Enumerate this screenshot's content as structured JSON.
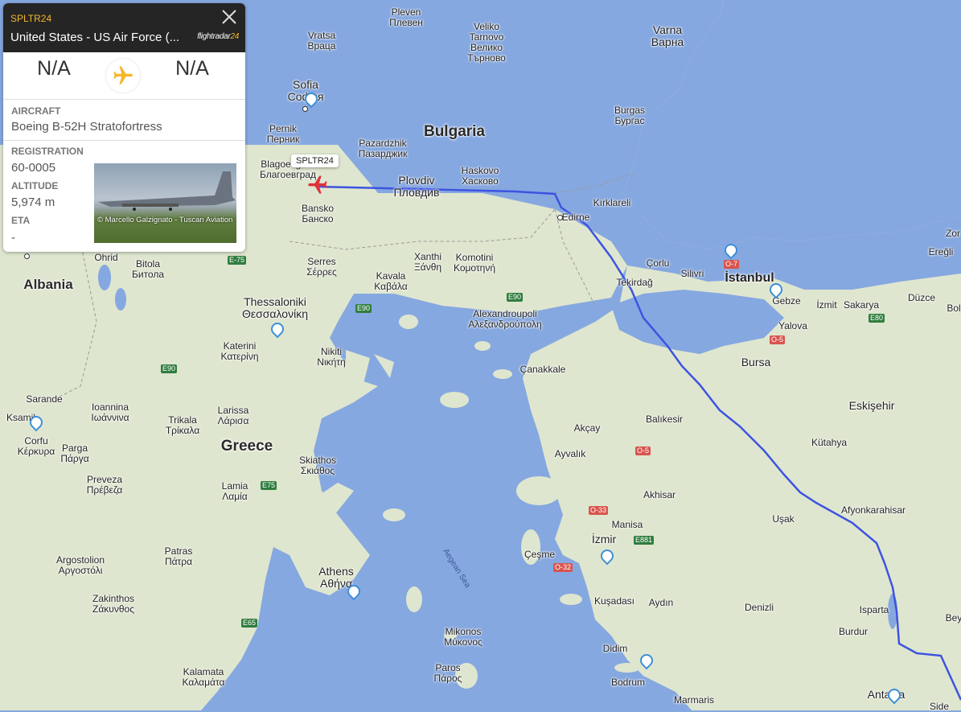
{
  "panel": {
    "callsign": "SPLTR24",
    "operator": "United States - US Air Force (...",
    "logo_main": "flightradar",
    "logo_num": "24",
    "origin": "N/A",
    "destination": "N/A",
    "aircraft_label": "AIRCRAFT",
    "aircraft_value": "Boeing B-52H Stratofortress",
    "registration_label": "REGISTRATION",
    "registration_value": "60-0005",
    "altitude_label": "ALTITUDE",
    "altitude_value": "5,974 m",
    "eta_label": "ETA",
    "eta_value": "-",
    "photo_credit": "© Marcello Galzignato - Tuscan Aviation",
    "close_icon": "close-icon",
    "plane_icon": "airplane-icon"
  },
  "flight_tag": "SPLTR24",
  "colors": {
    "sea": "#86a8e0",
    "land": "#dfe6cf",
    "track": "#3d54e0",
    "accent": "#f5b72a",
    "plane": "#e0303a"
  },
  "labels": {
    "pleven": "Pleven\nПлевен",
    "veliko": "Veliko\nTarnovo\nВелико\nТърново",
    "varna": "Varna\nВарна",
    "vratsa": "Vratsa\nВраца",
    "sofia": "Sofia\nСофия",
    "bulgaria": "Bulgaria",
    "burgas": "Burgas\nБургас",
    "pernik": "Pernik\nПерник",
    "pazardzhik": "Pazardzhik\nПазарджик",
    "blagoevgrad": "Blagoevgrad\nБлагоевград",
    "plovdiv": "Plovdiv\nПловдив",
    "haskovo": "Haskovo\nХасково",
    "kirklareli": "Kırklareli",
    "edirne": "Edirne",
    "bansko": "Bansko\nБанско",
    "ohrid": "Ohrid",
    "bitola": "Bitola\nБитола",
    "albania": "Albania",
    "serres": "Serres\nΣέρρες",
    "xanthi": "Xanthi\nΞάνθη",
    "komotini": "Komotini\nΚομοτηνή",
    "kavala": "Kavala\nΚαβάλα",
    "corlu": "Çorlu",
    "silivri": "Silivri",
    "istanbul": "İstanbul",
    "tekirdag": "Tekirdağ",
    "gebze": "Gebze",
    "izmit": "İzmit",
    "sakarya": "Sakarya",
    "duzce": "Düzce",
    "eregli": "Ereğli",
    "zor": "Zor",
    "bol": "Bol",
    "yalova": "Yalova",
    "thessaloniki": "Thessaloniki\nΘεσσαλονίκη",
    "alexandroupoli": "Alexandroupoli\nΑλεξανδρούπολη",
    "katerini": "Katerini\nΚατερίνη",
    "nikiti": "Nikiti\nΝικήτη",
    "canakkale": "Çanakkale",
    "bursa": "Bursa",
    "eskisehir": "Eskişehir",
    "sarande": "Sarande",
    "ksamil": "Ksamil",
    "ioannina": "Ioannina\nΙωάννινα",
    "trikala": "Trikala\nΤρίκαλα",
    "larissa": "Larissa\nΛάρισα",
    "corfu": "Corfu\nΚέρκυρα",
    "parga": "Parga\nΠάργα",
    "balikesir": "Balıkesir",
    "kutahya": "Kütahya",
    "akcay": "Akçay",
    "ayvalik": "Ayvalık",
    "greece": "Greece",
    "skiathos": "Skiathos\nΣκιάθος",
    "preveza": "Preveza\nΠρέβεζα",
    "lamia": "Lamia\nΛαμία",
    "akhisar": "Akhisar",
    "afyon": "Afyonkarahisar",
    "usak": "Uşak",
    "manisa": "Manisa",
    "izmir": "İzmir",
    "cesme": "Çeşme",
    "argostolion": "Argostolion\nΑργοστόλι",
    "patras": "Patras\nΠάτρα",
    "athens": "Athens\nΑθήνα",
    "aegean": "Aegean Sea",
    "kusadasi": "Kuşadası",
    "aydin": "Aydın",
    "denizli": "Denizli",
    "isparta": "Isparta",
    "burdur": "Burdur",
    "zakinthos": "Zakinthos\nΖάκυνθος",
    "mikonos": "Mikonos\nΜύκονος",
    "didim": "Didim",
    "paros": "Paros\nΠάρος",
    "bodrum": "Bodrum",
    "kalamata": "Kalamata\nΚαλαμάτα",
    "marmaris": "Marmaris",
    "antalya": "Antalya",
    "side": "Side",
    "bey": "Bey"
  },
  "roads": {
    "e75a": "E-75",
    "e90a": "E90",
    "e90b": "E90",
    "e90c": "E90",
    "e80": "E80",
    "o7": "O-7",
    "o5a": "O-5",
    "o5b": "O-5",
    "o33": "O-33",
    "o32": "O-32",
    "e881": "E881",
    "e75b": "E75",
    "e65": "E65"
  }
}
